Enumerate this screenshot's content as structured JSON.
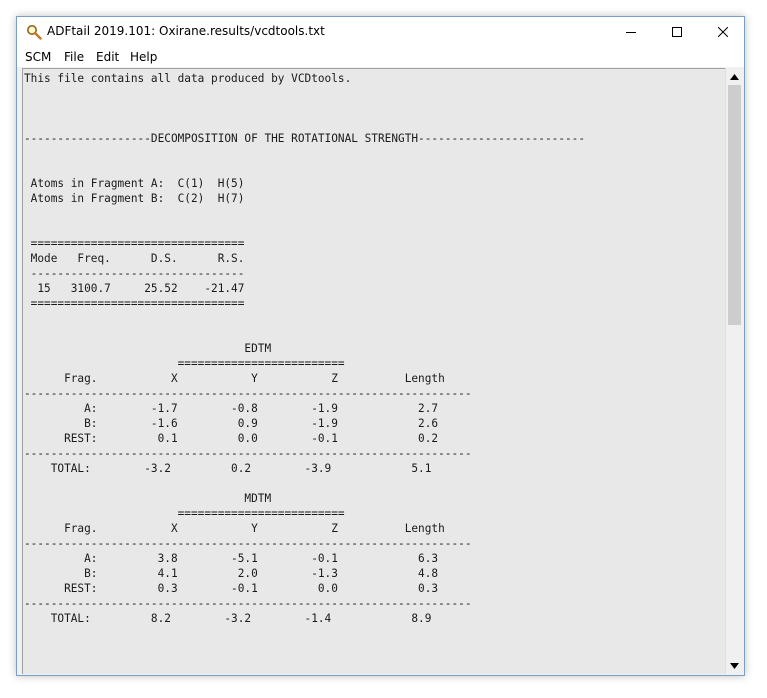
{
  "window": {
    "title": "ADFtail 2019.101: Oxirane.results/vcdtools.txt"
  },
  "menu": [
    "SCM",
    "File",
    "Edit",
    "Help"
  ],
  "file_lines": [
    "This file contains all data produced by VCDtools.",
    "",
    "",
    "",
    "-------------------DECOMPOSITION OF THE ROTATIONAL STRENGTH-------------------------",
    "",
    "",
    " Atoms in Fragment A:  C(1)  H(5)",
    " Atoms in Fragment B:  C(2)  H(7)",
    "",
    "",
    " ================================",
    " Mode   Freq.      D.S.      R.S.",
    " --------------------------------",
    "  15   3100.7     25.52    -21.47",
    " ================================",
    "",
    "",
    "                                 EDTM",
    "                       =========================",
    "      Frag.           X           Y           Z          Length",
    "-------------------------------------------------------------------",
    "         A:        -1.7        -0.8        -1.9            2.7",
    "         B:        -1.6         0.9        -1.9            2.6",
    "      REST:         0.1         0.0        -0.1            0.2",
    "-------------------------------------------------------------------",
    "    TOTAL:        -3.2         0.2        -3.9            5.1",
    "",
    "                                 MDTM",
    "                       =========================",
    "      Frag.           X           Y           Z          Length",
    "-------------------------------------------------------------------",
    "         A:         3.8        -5.1        -0.1            6.3",
    "         B:         4.1         2.0        -1.3            4.8",
    "      REST:         0.3        -0.1         0.0            0.3",
    "-------------------------------------------------------------------",
    "    TOTAL:         8.2        -3.2        -1.4            8.9"
  ],
  "icons": {
    "app": "magnifier-icon",
    "minimize": "minimize-icon",
    "maximize": "maximize-icon",
    "close": "close-icon",
    "scroll_up": "scroll-up-arrow-icon",
    "scroll_down": "scroll-down-arrow-icon"
  },
  "colors": {
    "text_area_bg": "#e8e8e8",
    "window_frame": "#7a9ec7",
    "scrollbar_thumb": "#cdcdcd"
  }
}
